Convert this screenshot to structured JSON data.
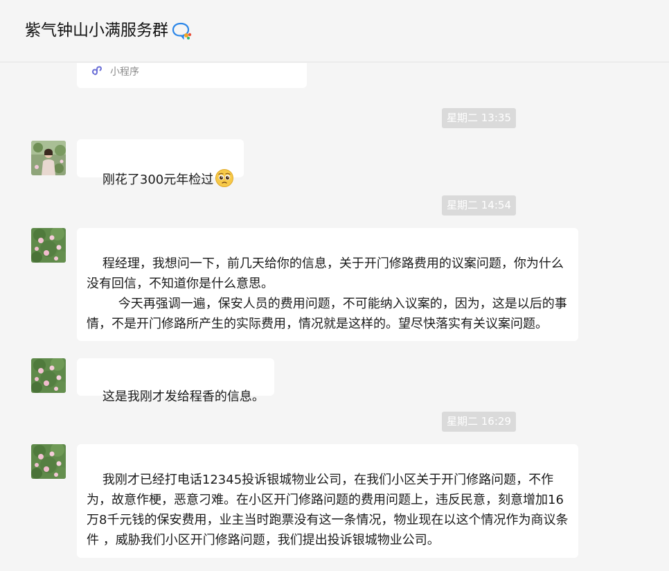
{
  "header": {
    "title": "紫气钟山小满服务群"
  },
  "chat": {
    "mini_program_label": "小程序",
    "timestamps": [
      "星期二 13:35",
      "星期二 14:54",
      "星期二 16:29"
    ],
    "messages": [
      {
        "text": "刚花了300元年检过",
        "emoji": "pleading-face-emoji"
      },
      {
        "text": "程经理，我想问一下，前几天给你的信息，关于开门修路费用的议案问题，你为什么没有回信，不知道你是什么意思。\n        今天再强调一遍，保安人员的费用问题，不可能纳入议案的，因为，这是以后的事情，不是开门修路所产生的实际费用，情况就是这样的。望尽快落实有关议案问题。"
      },
      {
        "text": "这是我刚才发给程香的信息。"
      },
      {
        "text": "我刚才已经打电话12345投诉银城物业公司，在我们小区关于开门修路问题，不作为，故意作梗，恶意刁难。在小区开门修路问题的费用问题上，违反民意，刻意增加16万8千元钱的保安费用，业主当时跑票没有这一条情况，物业现在以这个情况作为商议条件 ，威胁我们小区开门修路问题，我们提出投诉银城物业公司。"
      }
    ]
  },
  "colors": {
    "background": "#f5f5f5",
    "bubble": "#ffffff",
    "timestamp_bg": "#dadada",
    "mini_program_icon": "#6b6fd6"
  }
}
